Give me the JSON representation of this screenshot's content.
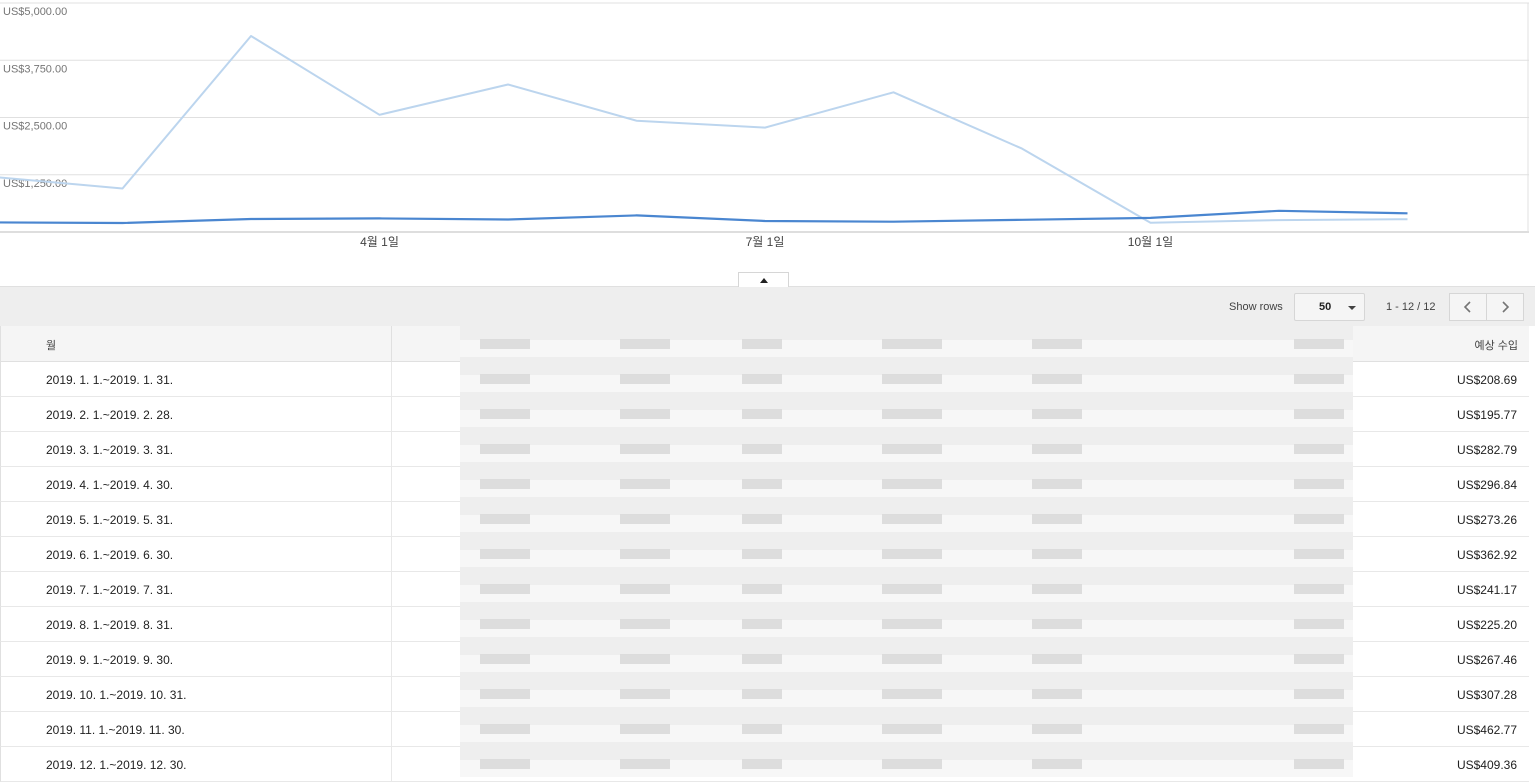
{
  "chart_data": {
    "type": "line",
    "y_tick_labels": [
      "US$5,000.00",
      "US$3,750.00",
      "US$2,500.00",
      "US$1,250.00"
    ],
    "y_ticks": [
      5000,
      3750,
      2500,
      1250
    ],
    "ylim": [
      0,
      5000
    ],
    "x_tick_labels": [
      "4월 1일",
      "7월 1일",
      "10월 1일"
    ],
    "x_tick_months": [
      4,
      7,
      10
    ],
    "x_months": [
      1,
      2,
      3,
      4,
      5,
      6,
      7,
      8,
      9,
      10,
      11,
      12
    ],
    "grid": true,
    "series": [
      {
        "color": "#bcd5ee",
        "values": [
          1200,
          950,
          4280,
          2560,
          3220,
          2430,
          2280,
          3050,
          1820,
          200,
          260,
          280
        ]
      },
      {
        "color": "#4a86d0",
        "values": [
          208.69,
          195.77,
          282.79,
          296.84,
          273.26,
          362.92,
          241.17,
          225.2,
          267.46,
          307.28,
          462.77,
          409.36
        ]
      }
    ]
  },
  "toolbar": {
    "show_rows_label": "Show rows",
    "rows_value": "50",
    "page_range": "1 - 12 / 12"
  },
  "table": {
    "header_month": "월",
    "header_revenue": "예상 수입",
    "rows": [
      {
        "month": "2019. 1. 1.~2019. 1. 31.",
        "revenue": "US$208.69"
      },
      {
        "month": "2019. 2. 1.~2019. 2. 28.",
        "revenue": "US$195.77"
      },
      {
        "month": "2019. 3. 1.~2019. 3. 31.",
        "revenue": "US$282.79"
      },
      {
        "month": "2019. 4. 1.~2019. 4. 30.",
        "revenue": "US$296.84"
      },
      {
        "month": "2019. 5. 1.~2019. 5. 31.",
        "revenue": "US$273.26"
      },
      {
        "month": "2019. 6. 1.~2019. 6. 30.",
        "revenue": "US$362.92"
      },
      {
        "month": "2019. 7. 1.~2019. 7. 31.",
        "revenue": "US$241.17"
      },
      {
        "month": "2019. 8. 1.~2019. 8. 31.",
        "revenue": "US$225.20"
      },
      {
        "month": "2019. 9. 1.~2019. 9. 30.",
        "revenue": "US$267.46"
      },
      {
        "month": "2019. 10. 1.~2019. 10. 31.",
        "revenue": "US$307.28"
      },
      {
        "month": "2019. 11. 1.~2019. 11. 30.",
        "revenue": "US$462.77"
      },
      {
        "month": "2019. 12. 1.~2019. 12. 30.",
        "revenue": "US$409.36"
      }
    ]
  }
}
